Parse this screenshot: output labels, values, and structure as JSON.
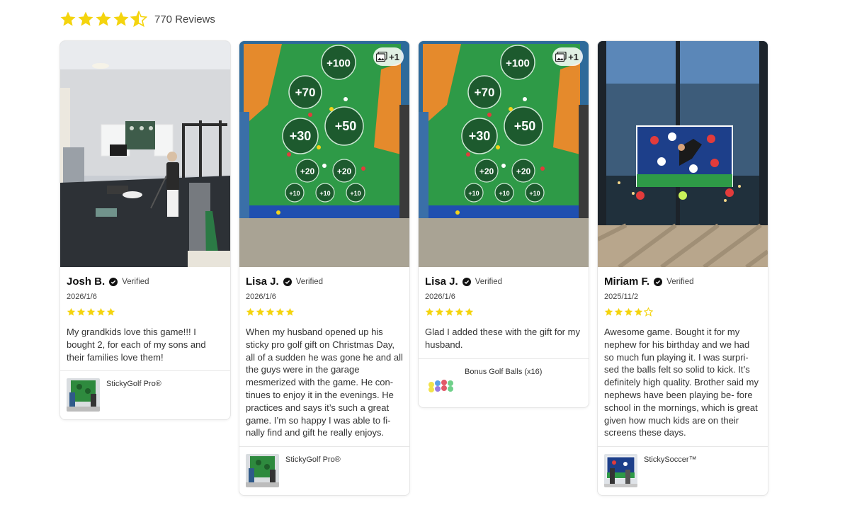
{
  "summary": {
    "rating": 4.5,
    "count_label": "770 Reviews"
  },
  "colors": {
    "star": "#f4d40e",
    "star_empty": "#d9d9d9"
  },
  "reviews": [
    {
      "name": "Josh B.",
      "verified_label": "Verified",
      "date": "2026/1/6",
      "rating": 5,
      "text": "My grandkids love this game!!! I bought 2, for each of my sons and their families love them!",
      "product": "StickyGolf Pro®",
      "photo_scene": "home-gym-golf",
      "extra_photos": ""
    },
    {
      "name": "Lisa J.",
      "verified_label": "Verified",
      "date": "2026/1/6",
      "rating": 5,
      "text": "When my husband opened up  his sticky pro  golf gift on Christmas Day,  all of a sudden he was gone he and all the guys were in the garage mesmerized with the game. He con- tinues to enjoy it in the evenings. He practices and says it’s such a great game. I’m so happy I was able to fi- nally find and gift he really enjoys.",
      "product": "StickyGolf Pro®",
      "photo_scene": "golf-target-mat",
      "extra_photos": "+1"
    },
    {
      "name": "Lisa J.",
      "verified_label": "Verified",
      "date": "2026/1/6",
      "rating": 5,
      "text": "Glad I added these with the gift for my husband.",
      "product": "Bonus Golf Balls (x16)",
      "photo_scene": "golf-target-mat",
      "extra_photos": "+1"
    },
    {
      "name": "Miriam F.",
      "verified_label": "Verified",
      "date": "2025/11/2",
      "rating": 4,
      "text": "Awesome game. Bought it for my nephew for his birthday and we had so much fun playing it. I was surpri- sed the balls felt so solid to kick. It’s definitely high quality. Brother said my nephews have been playing be- fore school in the mornings, which is great given how much kids are on their screens these days.",
      "product": "StickySoccer™",
      "photo_scene": "soccer-goal-window",
      "extra_photos": ""
    }
  ]
}
